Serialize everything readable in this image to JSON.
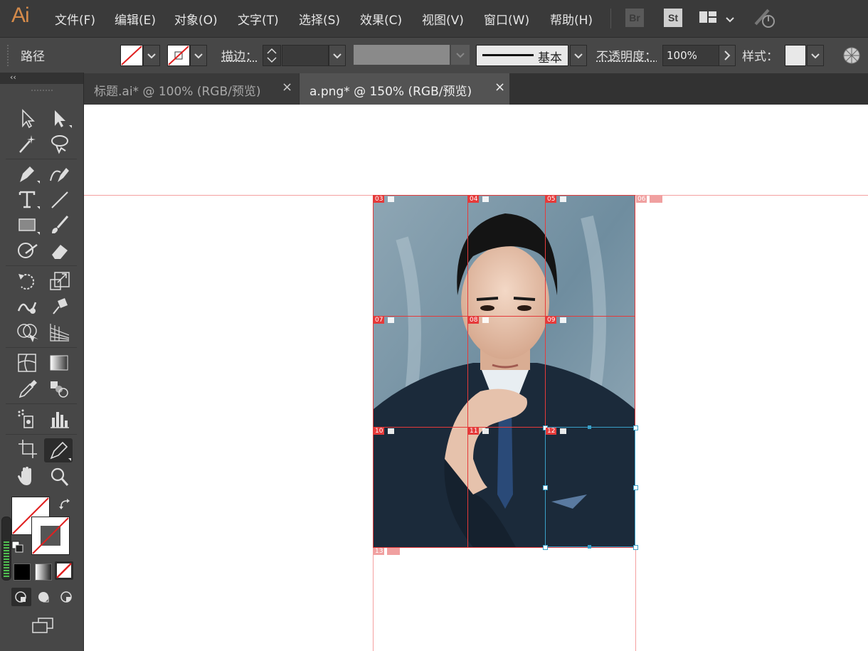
{
  "app": {
    "logo": "Ai"
  },
  "menu": [
    "文件(F)",
    "编辑(E)",
    "对象(O)",
    "文字(T)",
    "选择(S)",
    "效果(C)",
    "视图(V)",
    "窗口(W)",
    "帮助(H)"
  ],
  "menubar_icons": {
    "bridge": "Br",
    "stock": "St"
  },
  "control": {
    "object_type": "路径",
    "stroke_label": "描边：",
    "stroke_style": "基本",
    "opacity_label": "不透明度：",
    "opacity_value": "100%",
    "style_label": "样式："
  },
  "tabs": [
    {
      "label": "标题.ai* @ 100% (RGB/预览)",
      "active": false,
      "close": "×"
    },
    {
      "label": "a.png* @ 150% (RGB/预览)",
      "active": true,
      "close": "×"
    }
  ],
  "toolbar_collapse": "‹‹",
  "slices": {
    "s03": "03",
    "s04": "04",
    "s05": "05",
    "s06": "06",
    "s07": "07",
    "s08": "08",
    "s09": "09",
    "s10": "10",
    "s11": "11",
    "s12": "12",
    "s13": "13"
  },
  "colors": {
    "accent": "#d48a4a",
    "slice": "#e53a3a",
    "selection": "#3aa0c8"
  }
}
